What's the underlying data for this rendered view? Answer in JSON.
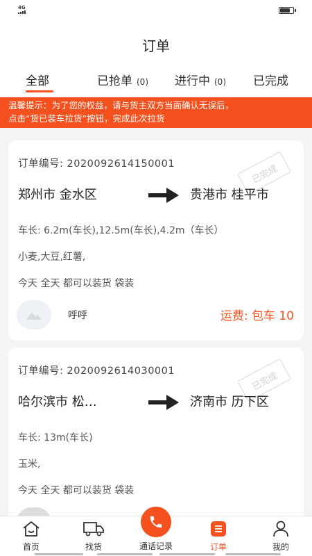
{
  "status_bar": {
    "network": "4G",
    "battery_level": 0.85
  },
  "header": {
    "title": "订单"
  },
  "tabs": [
    {
      "label": "全部",
      "count": ""
    },
    {
      "label": "已抢单",
      "count": "(0)"
    },
    {
      "label": "进行中",
      "count": "(0)"
    },
    {
      "label": "已完成",
      "count": ""
    }
  ],
  "notice": {
    "line1": "温馨提示：为了您的权益，请与货主双方当面确认无误后，",
    "line2": "点击“货已装车拉货”按钮，完成此次拉货"
  },
  "orders": [
    {
      "order_no": "订单编号:  2020092614150001",
      "from": "郑州市  金水区",
      "to": "贵港市  桂平市",
      "length": "车长:    6.2m(车长),12.5m(车长),4.2m（车长）",
      "goods": "小麦,大豆,红薯,",
      "loading": "今天  全天  都可以装货     袋装",
      "stamp": "已完成",
      "owner": "呼呼",
      "fee": "运费: 包车  10"
    },
    {
      "order_no": "订单编号:  2020092614030001",
      "from": "哈尔滨市   松…",
      "to": "济南市  历下区",
      "length": "车长:    13m(车长)",
      "goods": "玉米,",
      "loading": "今天  全天  都可以装货     袋装",
      "stamp": "已完成"
    }
  ],
  "bottom_nav": {
    "home": "首页",
    "find_goods": "找货",
    "call_log": "通话记录",
    "orders": "订单",
    "mine": "我的"
  },
  "colors": {
    "accent": "#f4511e"
  }
}
